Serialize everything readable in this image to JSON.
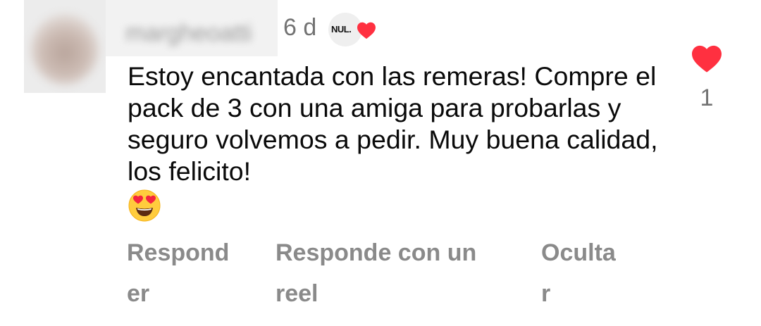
{
  "comment": {
    "username": "margheoatti",
    "time": "6 d",
    "creator_badge": "NUL.",
    "text": "Estoy encantada con las remeras! Compre el pack de 3 con una amiga para probarlas y seguro volvemos a pedir. Muy buena calidad, los felicito!",
    "emoji": "smiling-face-with-heart-eyes",
    "like_count": "1",
    "liked": true,
    "like_color": "#ff3040"
  },
  "actions": {
    "reply_label_line1": "Respond",
    "reply_label_line2": "er",
    "reel_label_line1": "Responde con un",
    "reel_label_line2": "reel",
    "hide_label_line1": "Oculta",
    "hide_label_line2": "r"
  }
}
